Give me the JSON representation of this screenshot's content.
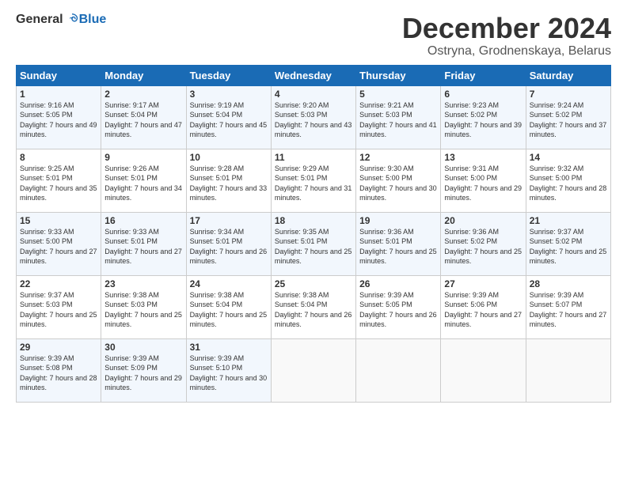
{
  "logo": {
    "general": "General",
    "blue": "Blue"
  },
  "title": "December 2024",
  "subtitle": "Ostryna, Grodnenskaya, Belarus",
  "days_header": [
    "Sunday",
    "Monday",
    "Tuesday",
    "Wednesday",
    "Thursday",
    "Friday",
    "Saturday"
  ],
  "weeks": [
    [
      {
        "day": "1",
        "sunrise": "Sunrise: 9:16 AM",
        "sunset": "Sunset: 5:05 PM",
        "daylight": "Daylight: 7 hours and 49 minutes."
      },
      {
        "day": "2",
        "sunrise": "Sunrise: 9:17 AM",
        "sunset": "Sunset: 5:04 PM",
        "daylight": "Daylight: 7 hours and 47 minutes."
      },
      {
        "day": "3",
        "sunrise": "Sunrise: 9:19 AM",
        "sunset": "Sunset: 5:04 PM",
        "daylight": "Daylight: 7 hours and 45 minutes."
      },
      {
        "day": "4",
        "sunrise": "Sunrise: 9:20 AM",
        "sunset": "Sunset: 5:03 PM",
        "daylight": "Daylight: 7 hours and 43 minutes."
      },
      {
        "day": "5",
        "sunrise": "Sunrise: 9:21 AM",
        "sunset": "Sunset: 5:03 PM",
        "daylight": "Daylight: 7 hours and 41 minutes."
      },
      {
        "day": "6",
        "sunrise": "Sunrise: 9:23 AM",
        "sunset": "Sunset: 5:02 PM",
        "daylight": "Daylight: 7 hours and 39 minutes."
      },
      {
        "day": "7",
        "sunrise": "Sunrise: 9:24 AM",
        "sunset": "Sunset: 5:02 PM",
        "daylight": "Daylight: 7 hours and 37 minutes."
      }
    ],
    [
      {
        "day": "8",
        "sunrise": "Sunrise: 9:25 AM",
        "sunset": "Sunset: 5:01 PM",
        "daylight": "Daylight: 7 hours and 35 minutes."
      },
      {
        "day": "9",
        "sunrise": "Sunrise: 9:26 AM",
        "sunset": "Sunset: 5:01 PM",
        "daylight": "Daylight: 7 hours and 34 minutes."
      },
      {
        "day": "10",
        "sunrise": "Sunrise: 9:28 AM",
        "sunset": "Sunset: 5:01 PM",
        "daylight": "Daylight: 7 hours and 33 minutes."
      },
      {
        "day": "11",
        "sunrise": "Sunrise: 9:29 AM",
        "sunset": "Sunset: 5:01 PM",
        "daylight": "Daylight: 7 hours and 31 minutes."
      },
      {
        "day": "12",
        "sunrise": "Sunrise: 9:30 AM",
        "sunset": "Sunset: 5:00 PM",
        "daylight": "Daylight: 7 hours and 30 minutes."
      },
      {
        "day": "13",
        "sunrise": "Sunrise: 9:31 AM",
        "sunset": "Sunset: 5:00 PM",
        "daylight": "Daylight: 7 hours and 29 minutes."
      },
      {
        "day": "14",
        "sunrise": "Sunrise: 9:32 AM",
        "sunset": "Sunset: 5:00 PM",
        "daylight": "Daylight: 7 hours and 28 minutes."
      }
    ],
    [
      {
        "day": "15",
        "sunrise": "Sunrise: 9:33 AM",
        "sunset": "Sunset: 5:00 PM",
        "daylight": "Daylight: 7 hours and 27 minutes."
      },
      {
        "day": "16",
        "sunrise": "Sunrise: 9:33 AM",
        "sunset": "Sunset: 5:01 PM",
        "daylight": "Daylight: 7 hours and 27 minutes."
      },
      {
        "day": "17",
        "sunrise": "Sunrise: 9:34 AM",
        "sunset": "Sunset: 5:01 PM",
        "daylight": "Daylight: 7 hours and 26 minutes."
      },
      {
        "day": "18",
        "sunrise": "Sunrise: 9:35 AM",
        "sunset": "Sunset: 5:01 PM",
        "daylight": "Daylight: 7 hours and 25 minutes."
      },
      {
        "day": "19",
        "sunrise": "Sunrise: 9:36 AM",
        "sunset": "Sunset: 5:01 PM",
        "daylight": "Daylight: 7 hours and 25 minutes."
      },
      {
        "day": "20",
        "sunrise": "Sunrise: 9:36 AM",
        "sunset": "Sunset: 5:02 PM",
        "daylight": "Daylight: 7 hours and 25 minutes."
      },
      {
        "day": "21",
        "sunrise": "Sunrise: 9:37 AM",
        "sunset": "Sunset: 5:02 PM",
        "daylight": "Daylight: 7 hours and 25 minutes."
      }
    ],
    [
      {
        "day": "22",
        "sunrise": "Sunrise: 9:37 AM",
        "sunset": "Sunset: 5:03 PM",
        "daylight": "Daylight: 7 hours and 25 minutes."
      },
      {
        "day": "23",
        "sunrise": "Sunrise: 9:38 AM",
        "sunset": "Sunset: 5:03 PM",
        "daylight": "Daylight: 7 hours and 25 minutes."
      },
      {
        "day": "24",
        "sunrise": "Sunrise: 9:38 AM",
        "sunset": "Sunset: 5:04 PM",
        "daylight": "Daylight: 7 hours and 25 minutes."
      },
      {
        "day": "25",
        "sunrise": "Sunrise: 9:38 AM",
        "sunset": "Sunset: 5:04 PM",
        "daylight": "Daylight: 7 hours and 26 minutes."
      },
      {
        "day": "26",
        "sunrise": "Sunrise: 9:39 AM",
        "sunset": "Sunset: 5:05 PM",
        "daylight": "Daylight: 7 hours and 26 minutes."
      },
      {
        "day": "27",
        "sunrise": "Sunrise: 9:39 AM",
        "sunset": "Sunset: 5:06 PM",
        "daylight": "Daylight: 7 hours and 27 minutes."
      },
      {
        "day": "28",
        "sunrise": "Sunrise: 9:39 AM",
        "sunset": "Sunset: 5:07 PM",
        "daylight": "Daylight: 7 hours and 27 minutes."
      }
    ],
    [
      {
        "day": "29",
        "sunrise": "Sunrise: 9:39 AM",
        "sunset": "Sunset: 5:08 PM",
        "daylight": "Daylight: 7 hours and 28 minutes."
      },
      {
        "day": "30",
        "sunrise": "Sunrise: 9:39 AM",
        "sunset": "Sunset: 5:09 PM",
        "daylight": "Daylight: 7 hours and 29 minutes."
      },
      {
        "day": "31",
        "sunrise": "Sunrise: 9:39 AM",
        "sunset": "Sunset: 5:10 PM",
        "daylight": "Daylight: 7 hours and 30 minutes."
      },
      null,
      null,
      null,
      null
    ]
  ]
}
